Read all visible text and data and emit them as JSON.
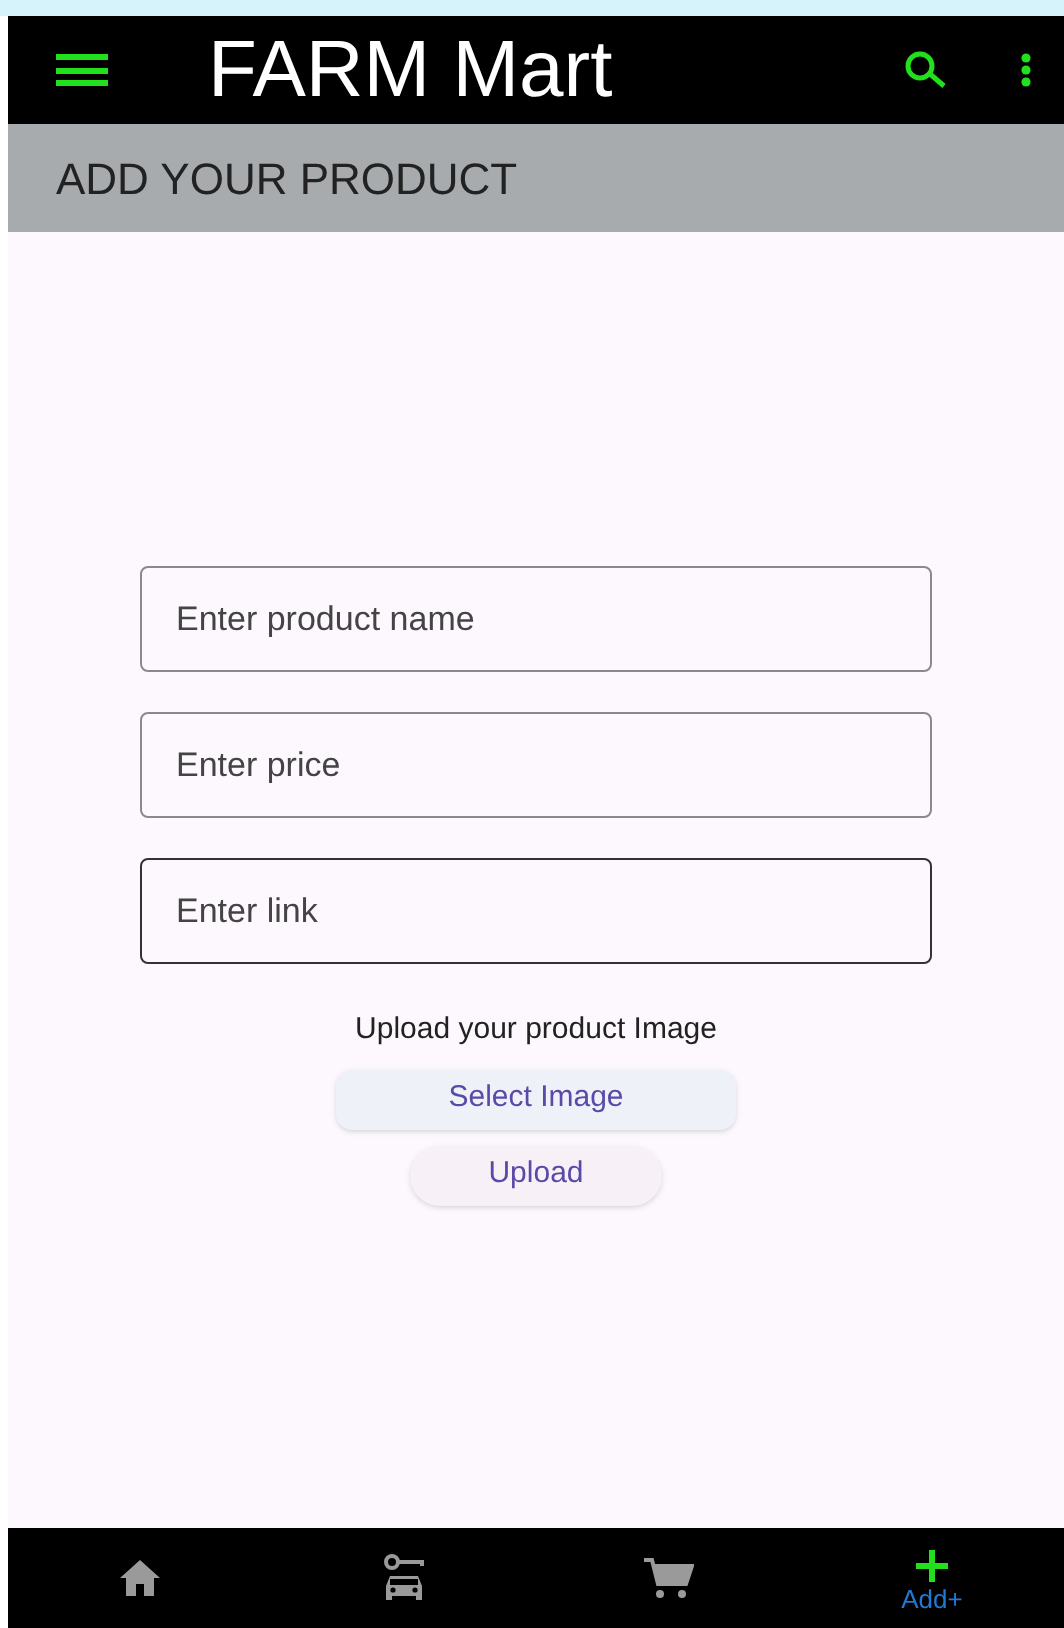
{
  "app_bar": {
    "title": "FARM Mart"
  },
  "page_header": {
    "title": "ADD YOUR PRODUCT"
  },
  "fields": [
    {
      "placeholder": "Enter product name",
      "focused": false
    },
    {
      "placeholder": "Enter price",
      "focused": false
    },
    {
      "placeholder": "Enter link",
      "focused": true
    }
  ],
  "upload": {
    "caption": "Upload your product Image",
    "buttons": [
      {
        "label": "Select Image",
        "kind": "tonal"
      },
      {
        "label": "Upload",
        "kind": "plain"
      }
    ]
  },
  "bottom_nav": [
    {
      "kind": "home",
      "selected": false
    },
    {
      "kind": "car",
      "selected": false
    },
    {
      "kind": "cart",
      "selected": false
    },
    {
      "kind": "add",
      "selected": true,
      "label": "Add+"
    }
  ]
}
